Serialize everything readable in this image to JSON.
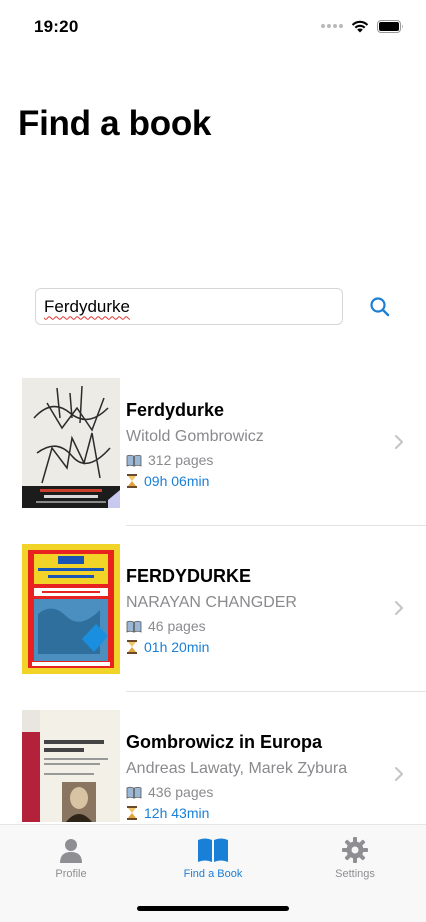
{
  "status_bar": {
    "time": "19:20",
    "icons": [
      "signal-dots-icon",
      "wifi-icon",
      "battery-icon"
    ]
  },
  "page_title": "Find a book",
  "search": {
    "value": "Ferdydurke",
    "placeholder": "",
    "button_icon": "magnifier-icon"
  },
  "books": [
    {
      "title": "Ferdydurke",
      "author": "Witold Gombrowicz",
      "pages": "312 pages",
      "duration": "09h 06min",
      "cover": {
        "brand_color": "#2b2b2b",
        "accent": "#c9402d",
        "text": "WITOLD GOMBROWICZ",
        "subtitle": "FERDYDURKE"
      }
    },
    {
      "title": "FERDYDURKE",
      "author": "NARAYAN CHANGDER",
      "pages": "46 pages",
      "duration": "01h 20min",
      "cover": {
        "brand_color": "#e8231f",
        "accent": "#f2d327",
        "text": "FERDYDURKE",
        "subtitle": "NARAYAN CHANGDER"
      }
    },
    {
      "title": "Gombrowicz in Europa",
      "author": "Andreas Lawaty, Marek Zybura",
      "pages": "436 pages",
      "duration": "12h 43min",
      "cover": {
        "brand_color": "#b3213a",
        "accent": "#f3f0e8",
        "text": "Gombrowicz in Europa",
        "subtitle": ""
      }
    }
  ],
  "tab_bar": {
    "tabs": [
      {
        "label": "Profile",
        "icon": "person-icon",
        "active": false
      },
      {
        "label": "Find a Book",
        "icon": "open-book-icon",
        "active": true
      },
      {
        "label": "Settings",
        "icon": "gear-icon",
        "active": false
      }
    ]
  },
  "colors": {
    "accent": "#1a7fd6",
    "secondary_text": "#8a8a8e",
    "tab_inactive": "#8e8e93"
  }
}
